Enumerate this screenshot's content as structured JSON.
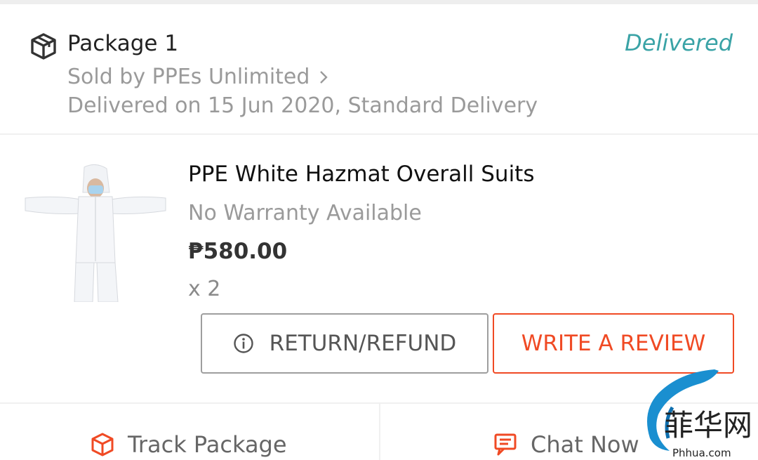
{
  "package": {
    "title": "Package 1",
    "status": "Delivered",
    "seller": "Sold by PPEs Unlimited",
    "delivery_info": "Delivered on 15 Jun 2020, Standard Delivery"
  },
  "product": {
    "title": "PPE White Hazmat Overall Suits",
    "warranty": "No Warranty Available",
    "price": "₱580.00",
    "quantity": "x 2"
  },
  "buttons": {
    "return_refund": "RETURN/REFUND",
    "write_review": "WRITE A REVIEW"
  },
  "actions": {
    "track_package": "Track Package",
    "chat_now": "Chat Now"
  },
  "watermark": {
    "url": "Phhua.com"
  },
  "colors": {
    "status_teal": "#3aa3a6",
    "accent_orange": "#f04a24"
  },
  "icons": [
    "package-icon",
    "chevron-right-icon",
    "info-icon",
    "track-package-icon",
    "chat-icon"
  ]
}
